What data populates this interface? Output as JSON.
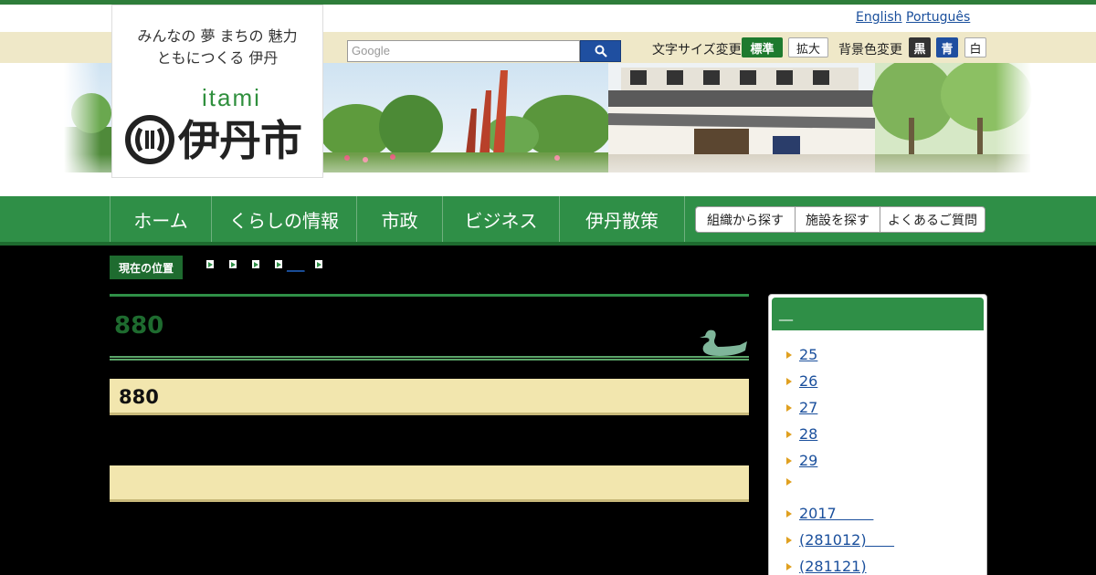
{
  "header": {
    "slogan_line1": "みんなの 夢 まちの 魅力",
    "slogan_line2": "ともにつくる 伊丹",
    "logo_roman": "itami",
    "logo_text": "伊丹市",
    "lang_english": "English",
    "lang_portuguese": "Português",
    "search_placeholder": "Google",
    "font_size_label": "文字サイズ変更",
    "font_standard": "標準",
    "font_large": "拡大",
    "bg_label": "背景色変更",
    "bg_black": "黒",
    "bg_blue": "青",
    "bg_white": "白"
  },
  "nav": {
    "items": [
      {
        "label": "ホーム"
      },
      {
        "label": "くらしの情報"
      },
      {
        "label": "市政"
      },
      {
        "label": "ビジネス"
      },
      {
        "label": "伊丹散策"
      }
    ],
    "sub": [
      {
        "label": "組織から探す"
      },
      {
        "label": "施設を探す"
      },
      {
        "label": "よくあるご質問"
      }
    ]
  },
  "breadcrumb": {
    "label": "現在の位置",
    "current": "___"
  },
  "main": {
    "title": "880",
    "section1": "880",
    "section2": ""
  },
  "sidebar": {
    "heading": "__",
    "items": [
      {
        "label": "25"
      },
      {
        "label": "26"
      },
      {
        "label": "27"
      },
      {
        "label": "28"
      },
      {
        "label": "29"
      },
      {
        "label": ""
      },
      {
        "label": "2017        "
      },
      {
        "label": "(281012)      "
      },
      {
        "label": "(281121)"
      }
    ]
  },
  "colors": {
    "brand_green": "#2f8f47",
    "dark_green": "#1e6b2f",
    "beige": "#f2e6ae",
    "link_blue": "#1a4f9c",
    "search_blue": "#1f4fa0"
  }
}
